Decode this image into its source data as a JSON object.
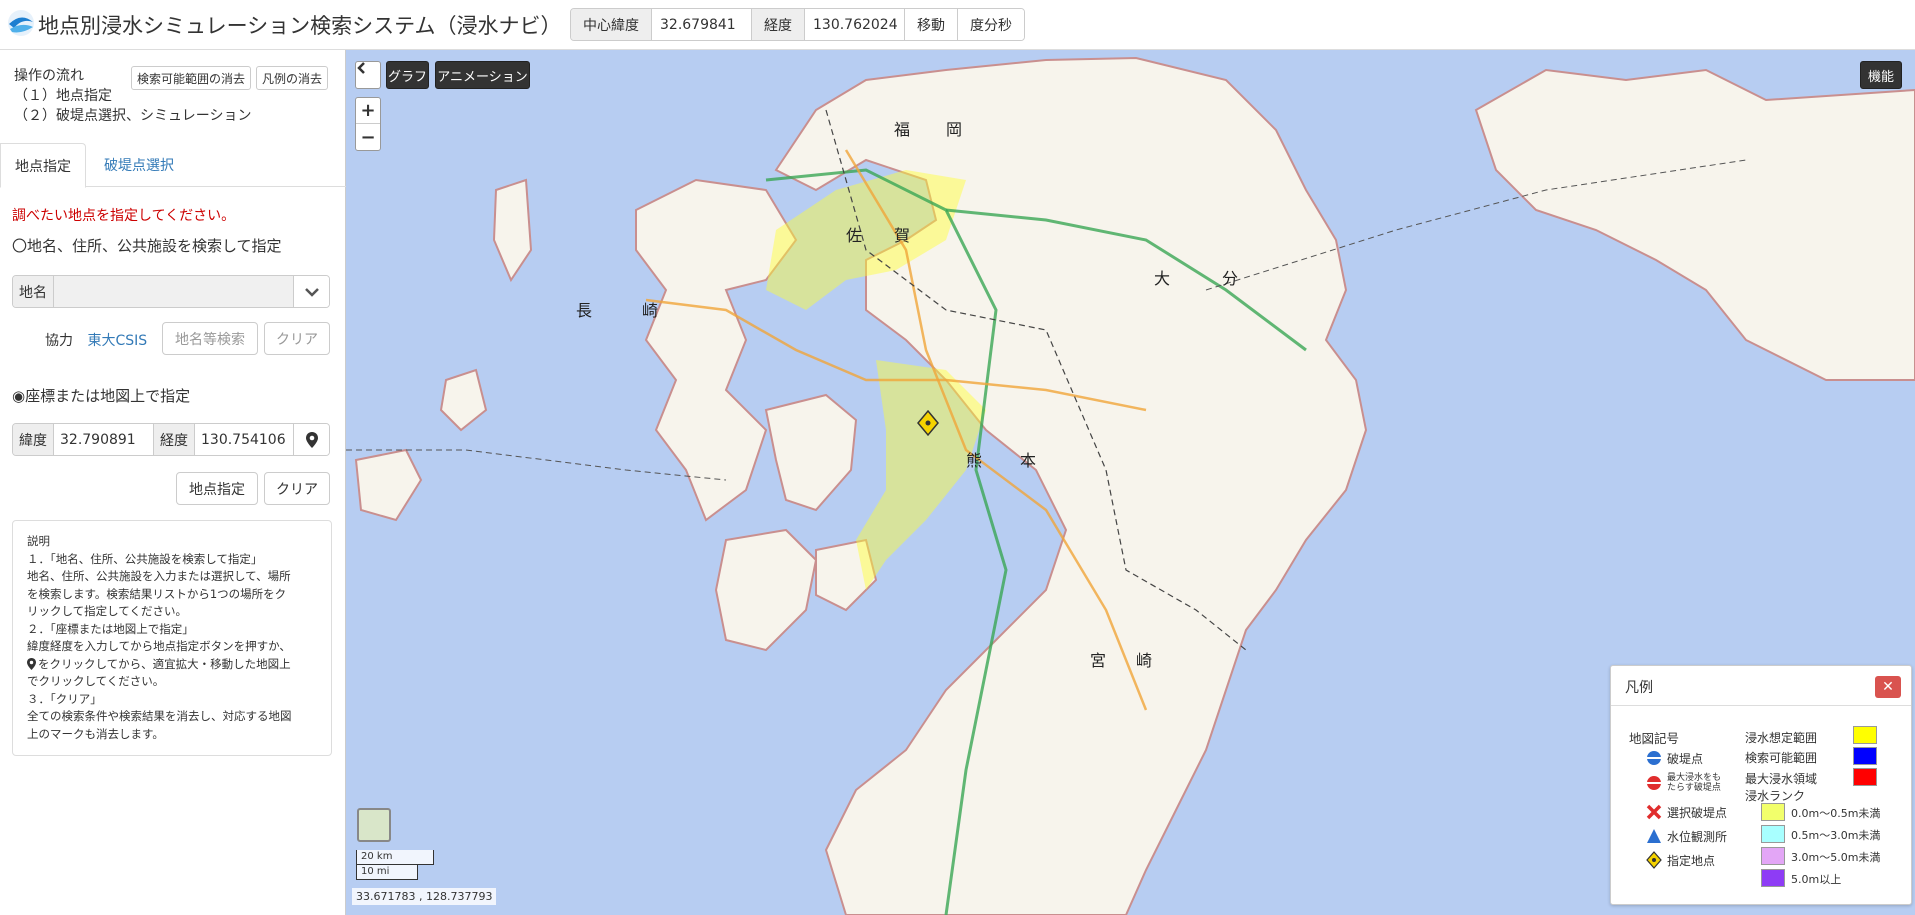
{
  "header": {
    "title": "地点別浸水シミュレーション検索システム（浸水ナビ）",
    "center_lat_label": "中心緯度",
    "center_lat_value": "32.679841",
    "lon_label": "経度",
    "lon_value": "130.762024",
    "move_button": "移動",
    "dms_button": "度分秒"
  },
  "sidebar": {
    "flow_title": "操作の流れ",
    "flow_step1": "（１）地点指定",
    "flow_step2": "（２）破堤点選択、シミュレーション",
    "clear_range_button": "検索可能範囲の消去",
    "clear_legend_button": "凡例の消去",
    "tabs": [
      {
        "label": "地点指定",
        "active": true
      },
      {
        "label": "破堤点選択",
        "active": false
      }
    ],
    "instruction": "調べたい地点を指定してください。",
    "search_radio_label": "〇地名、住所、公共施設を検索して指定",
    "place_label": "地名",
    "place_value": "",
    "cooperation_label": "協力",
    "cooperation_link": "東大CSIS",
    "place_search_button": "地名等検索",
    "clear_button_1": "クリア",
    "coord_radio_label": "◉座標または地図上で指定",
    "lat_label": "緯度",
    "lat_value": "32.790891",
    "lon_label": "経度",
    "lon_value": "130.754106",
    "set_point_button": "地点指定",
    "clear_button_2": "クリア",
    "description": {
      "title": "説明",
      "lines": [
        "１．「地名、住所、公共施設を検索して指定」",
        "地名、住所、公共施設を入力または選択して、場所",
        "を検索します。検索結果リストから1つの場所をク",
        "リックして指定してください。",
        "２．「座標または地図上で指定」",
        "緯度経度を入力してから地点指定ボタンを押すか、",
        "をクリックしてから、適宜拡大・移動した地図上",
        "でクリックしてください。",
        "３．「クリア」",
        "全ての検索条件や検索結果を消去し、対応する地図",
        "上のマークも消去します。"
      ]
    }
  },
  "map": {
    "graph_button": "グラフ",
    "animation_button": "アニメーション",
    "function_button": "機能",
    "scale_km": "20 km",
    "scale_mi": "10 mi",
    "cursor_coords": "33.671783 , 128.737793",
    "labels": {
      "fukuoka_1": "福",
      "fukuoka_2": "岡",
      "saga_1": "佐",
      "saga_2": "賀",
      "nagasaki_1": "長",
      "nagasaki_2": "崎",
      "oita_1": "大",
      "oita_2": "分",
      "kumamoto_1": "熊",
      "kumamoto_2": "本",
      "miyazaki_1": "宮",
      "miyazaki_2": "崎"
    }
  },
  "legend": {
    "title": "凡例",
    "symbols_heading": "地図記号",
    "break_point": "破堤点",
    "max_flood_break_point_1": "最大浸水をも",
    "max_flood_break_point_2": "たらす破堤点",
    "selected_break_point": "選択破堤点",
    "water_station": "水位観測所",
    "designated_point": "指定地点",
    "flood_area": "浸水想定範囲",
    "searchable_area": "検索可能範囲",
    "max_flood_area": "最大浸水領域",
    "rank_heading": "浸水ランク",
    "ranks": [
      "0.0m〜0.5m未満",
      "0.5m〜3.0m未満",
      "3.0m〜5.0m未満",
      "5.0m以上"
    ],
    "colors": {
      "flood_area": "#ffff00",
      "searchable_area": "#0000ff",
      "max_flood_area": "#ff0000",
      "rank1": "#f2ff6b",
      "rank2": "#a8ffff",
      "rank3": "#e3a6f6",
      "rank4": "#8e3cf5"
    }
  }
}
